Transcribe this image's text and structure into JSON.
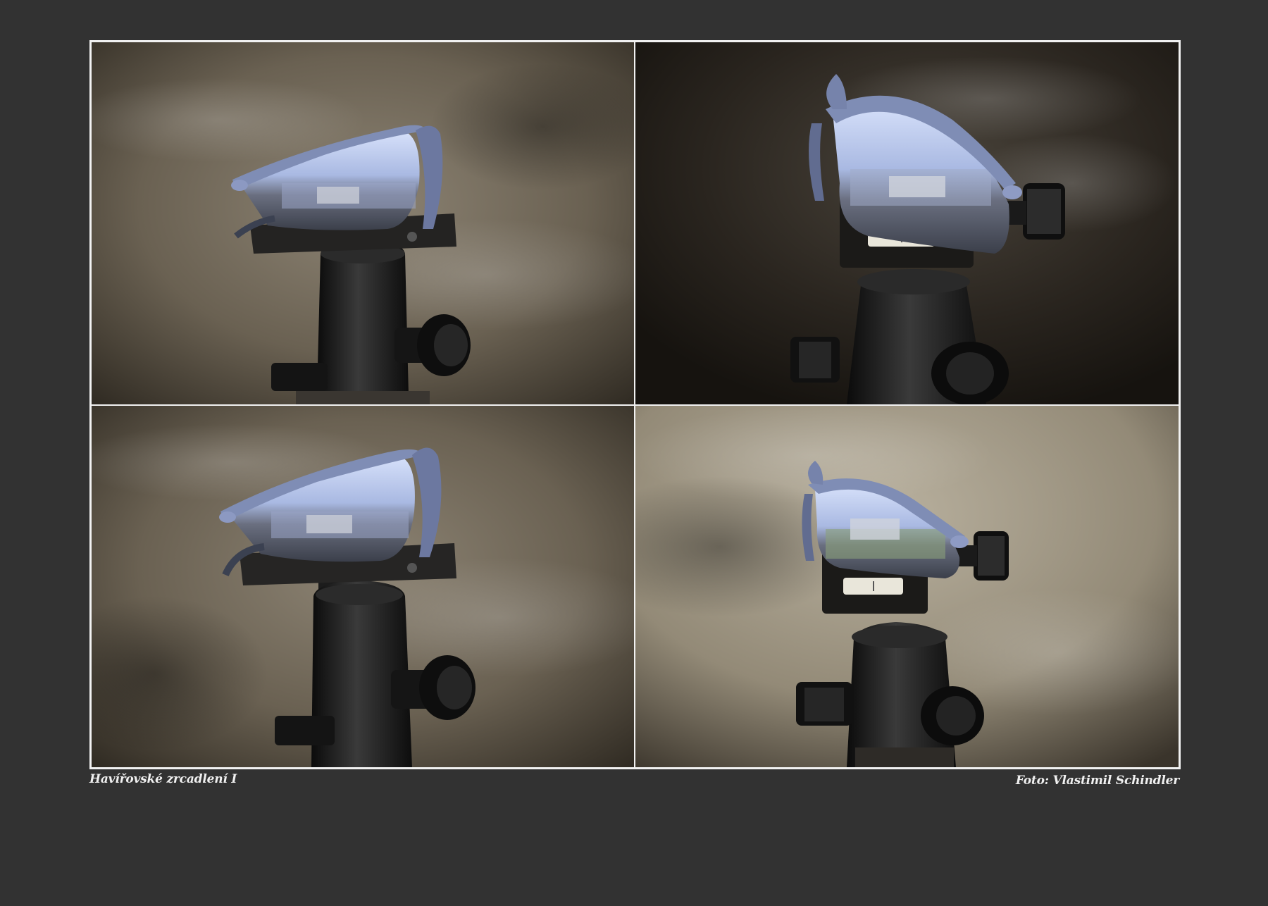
{
  "collage": {
    "title": "Havířovské zrcadlení I",
    "credit": "Foto: Vlastimil Schindler",
    "photos": [
      {
        "subject": "mirrored-sunglasses-on-tripod-head",
        "background": "warm-grey-mottled",
        "orientation": "facing-left"
      },
      {
        "subject": "mirrored-sunglasses-on-tripod-head",
        "background": "dark-brown",
        "orientation": "facing-right"
      },
      {
        "subject": "mirrored-sunglasses-on-tripod-head",
        "background": "warm-grey-mottled",
        "orientation": "facing-left"
      },
      {
        "subject": "mirrored-sunglasses-on-tripod-head",
        "background": "light-beige",
        "orientation": "facing-right"
      }
    ]
  },
  "colors": {
    "page_background": "#323232",
    "frame": "#f2f2f2",
    "lens_sky": "#b9c8ec",
    "lens_frame": "#7f8db5",
    "tripod": "#141414"
  }
}
